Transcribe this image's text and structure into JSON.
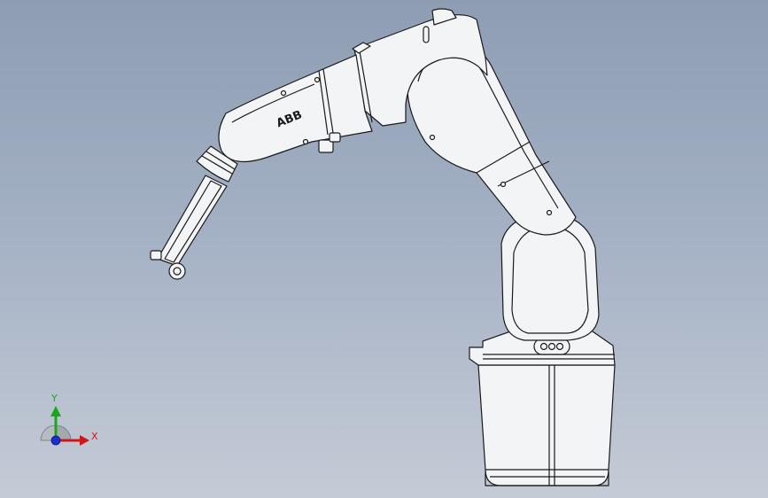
{
  "viewport": {
    "background_top": "#8e9db3",
    "background_bottom": "#c5cbd6"
  },
  "robot": {
    "brand_logo": "ABB",
    "body_color": "#f2f4f6",
    "outline_color": "#1a1a1a"
  },
  "axis_triad": {
    "y_label": "Y",
    "x_label": "X",
    "y_color": "#1aa81a",
    "x_color": "#d01818",
    "z_color": "#1a2fd0"
  }
}
